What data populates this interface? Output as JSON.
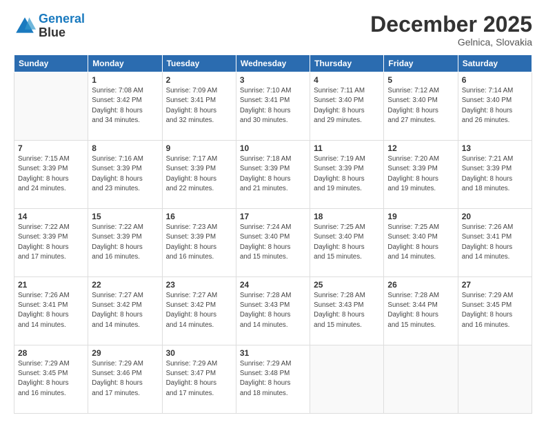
{
  "logo": {
    "line1": "General",
    "line2": "Blue"
  },
  "title": "December 2025",
  "location": "Gelnica, Slovakia",
  "days_of_week": [
    "Sunday",
    "Monday",
    "Tuesday",
    "Wednesday",
    "Thursday",
    "Friday",
    "Saturday"
  ],
  "weeks": [
    [
      {
        "day": "",
        "info": ""
      },
      {
        "day": "1",
        "info": "Sunrise: 7:08 AM\nSunset: 3:42 PM\nDaylight: 8 hours\nand 34 minutes."
      },
      {
        "day": "2",
        "info": "Sunrise: 7:09 AM\nSunset: 3:41 PM\nDaylight: 8 hours\nand 32 minutes."
      },
      {
        "day": "3",
        "info": "Sunrise: 7:10 AM\nSunset: 3:41 PM\nDaylight: 8 hours\nand 30 minutes."
      },
      {
        "day": "4",
        "info": "Sunrise: 7:11 AM\nSunset: 3:40 PM\nDaylight: 8 hours\nand 29 minutes."
      },
      {
        "day": "5",
        "info": "Sunrise: 7:12 AM\nSunset: 3:40 PM\nDaylight: 8 hours\nand 27 minutes."
      },
      {
        "day": "6",
        "info": "Sunrise: 7:14 AM\nSunset: 3:40 PM\nDaylight: 8 hours\nand 26 minutes."
      }
    ],
    [
      {
        "day": "7",
        "info": "Sunrise: 7:15 AM\nSunset: 3:39 PM\nDaylight: 8 hours\nand 24 minutes."
      },
      {
        "day": "8",
        "info": "Sunrise: 7:16 AM\nSunset: 3:39 PM\nDaylight: 8 hours\nand 23 minutes."
      },
      {
        "day": "9",
        "info": "Sunrise: 7:17 AM\nSunset: 3:39 PM\nDaylight: 8 hours\nand 22 minutes."
      },
      {
        "day": "10",
        "info": "Sunrise: 7:18 AM\nSunset: 3:39 PM\nDaylight: 8 hours\nand 21 minutes."
      },
      {
        "day": "11",
        "info": "Sunrise: 7:19 AM\nSunset: 3:39 PM\nDaylight: 8 hours\nand 19 minutes."
      },
      {
        "day": "12",
        "info": "Sunrise: 7:20 AM\nSunset: 3:39 PM\nDaylight: 8 hours\nand 19 minutes."
      },
      {
        "day": "13",
        "info": "Sunrise: 7:21 AM\nSunset: 3:39 PM\nDaylight: 8 hours\nand 18 minutes."
      }
    ],
    [
      {
        "day": "14",
        "info": "Sunrise: 7:22 AM\nSunset: 3:39 PM\nDaylight: 8 hours\nand 17 minutes."
      },
      {
        "day": "15",
        "info": "Sunrise: 7:22 AM\nSunset: 3:39 PM\nDaylight: 8 hours\nand 16 minutes."
      },
      {
        "day": "16",
        "info": "Sunrise: 7:23 AM\nSunset: 3:39 PM\nDaylight: 8 hours\nand 16 minutes."
      },
      {
        "day": "17",
        "info": "Sunrise: 7:24 AM\nSunset: 3:40 PM\nDaylight: 8 hours\nand 15 minutes."
      },
      {
        "day": "18",
        "info": "Sunrise: 7:25 AM\nSunset: 3:40 PM\nDaylight: 8 hours\nand 15 minutes."
      },
      {
        "day": "19",
        "info": "Sunrise: 7:25 AM\nSunset: 3:40 PM\nDaylight: 8 hours\nand 14 minutes."
      },
      {
        "day": "20",
        "info": "Sunrise: 7:26 AM\nSunset: 3:41 PM\nDaylight: 8 hours\nand 14 minutes."
      }
    ],
    [
      {
        "day": "21",
        "info": "Sunrise: 7:26 AM\nSunset: 3:41 PM\nDaylight: 8 hours\nand 14 minutes."
      },
      {
        "day": "22",
        "info": "Sunrise: 7:27 AM\nSunset: 3:42 PM\nDaylight: 8 hours\nand 14 minutes."
      },
      {
        "day": "23",
        "info": "Sunrise: 7:27 AM\nSunset: 3:42 PM\nDaylight: 8 hours\nand 14 minutes."
      },
      {
        "day": "24",
        "info": "Sunrise: 7:28 AM\nSunset: 3:43 PM\nDaylight: 8 hours\nand 14 minutes."
      },
      {
        "day": "25",
        "info": "Sunrise: 7:28 AM\nSunset: 3:43 PM\nDaylight: 8 hours\nand 15 minutes."
      },
      {
        "day": "26",
        "info": "Sunrise: 7:28 AM\nSunset: 3:44 PM\nDaylight: 8 hours\nand 15 minutes."
      },
      {
        "day": "27",
        "info": "Sunrise: 7:29 AM\nSunset: 3:45 PM\nDaylight: 8 hours\nand 16 minutes."
      }
    ],
    [
      {
        "day": "28",
        "info": "Sunrise: 7:29 AM\nSunset: 3:45 PM\nDaylight: 8 hours\nand 16 minutes."
      },
      {
        "day": "29",
        "info": "Sunrise: 7:29 AM\nSunset: 3:46 PM\nDaylight: 8 hours\nand 17 minutes."
      },
      {
        "day": "30",
        "info": "Sunrise: 7:29 AM\nSunset: 3:47 PM\nDaylight: 8 hours\nand 17 minutes."
      },
      {
        "day": "31",
        "info": "Sunrise: 7:29 AM\nSunset: 3:48 PM\nDaylight: 8 hours\nand 18 minutes."
      },
      {
        "day": "",
        "info": ""
      },
      {
        "day": "",
        "info": ""
      },
      {
        "day": "",
        "info": ""
      }
    ]
  ]
}
